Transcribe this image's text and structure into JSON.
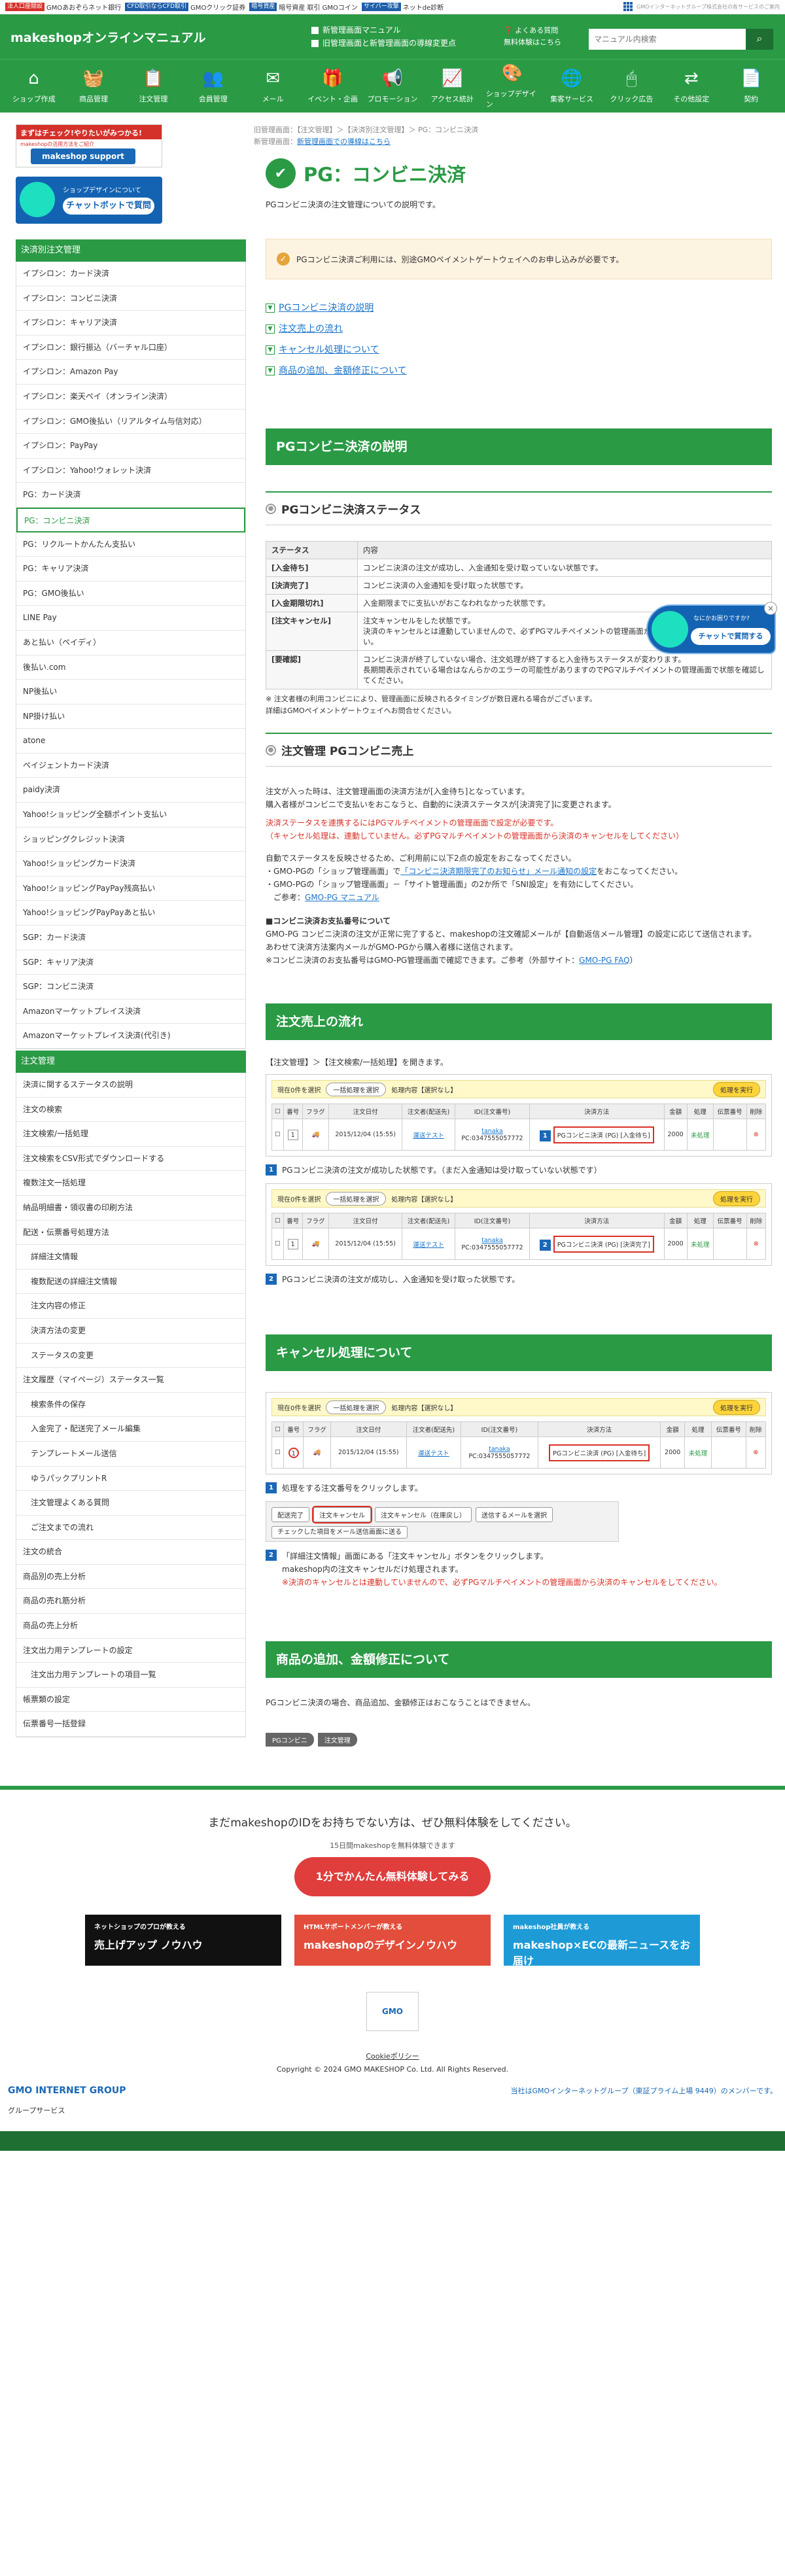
{
  "topbar": {
    "links": [
      {
        "tag": "法人口座開設",
        "tag_color": "#d4312b",
        "label": "GMOあおぞらネット銀行"
      },
      {
        "tag": "CFD取引ならCFD取引",
        "tag_color": "#1f5fa8",
        "label": "GMOクリック証券"
      },
      {
        "tag": "暗号資産",
        "tag_color": "#1f5fa8",
        "label": "暗号資産 取引 GMOコイン"
      },
      {
        "tag": "サイバー攻撃",
        "tag_color": "#1f5fa8",
        "label": "ネットde診断"
      }
    ],
    "right_text": "GMOインターネットグループ株式会社の各サービスのご案内"
  },
  "header": {
    "logo": "makeshopオンラインマニュアル",
    "link1": "新管理画面マニュアル",
    "link2": "旧管理画面と新管理画面の導線変更点",
    "faq": "よくある質問",
    "trial": "無料体験はこちら",
    "search_placeholder": "マニュアル内検索"
  },
  "iconnav": [
    {
      "label": "ショップ作成",
      "icon": "shop-icon"
    },
    {
      "label": "商品管理",
      "icon": "basket-icon"
    },
    {
      "label": "注文管理",
      "icon": "clipboard-icon"
    },
    {
      "label": "会員管理",
      "icon": "members-icon"
    },
    {
      "label": "メール",
      "icon": "mail-icon"
    },
    {
      "label": "イベント・企画",
      "icon": "gift-icon"
    },
    {
      "label": "プロモーション",
      "icon": "megaphone-icon"
    },
    {
      "label": "アクセス統計",
      "icon": "chart-icon"
    },
    {
      "label": "ショップデザイン",
      "icon": "palette-icon"
    },
    {
      "label": "集客サービス",
      "icon": "globe-icon"
    },
    {
      "label": "クリック広告",
      "icon": "click-icon"
    },
    {
      "label": "その他設定",
      "icon": "arrows-icon"
    },
    {
      "label": "契約",
      "icon": "contract-icon"
    }
  ],
  "sidebar": {
    "banner1": {
      "top": "まずはチェック!やりたいがみつかる!",
      "sub": "makeshopの活用方法をご紹介",
      "logo": "makeshop support"
    },
    "banner2": {
      "t1": "ショップデザインについて",
      "t2": "チャットボットで質問"
    },
    "section1": "決済別注文管理",
    "items1": [
      "イプシロン：カード決済",
      "イプシロン：コンビニ決済",
      "イプシロン：キャリア決済",
      "イプシロン：銀行振込（バーチャル口座）",
      "イプシロン：Amazon Pay",
      "イプシロン：楽天ペイ（オンライン決済）",
      "イプシロン：GMO後払い（リアルタイム与信対応）",
      "イプシロン：PayPay",
      "イプシロン：Yahoo!ウォレット決済",
      "PG：カード決済",
      "PG：コンビニ決済",
      "PG：リクルートかんたん支払い",
      "PG：キャリア決済",
      "PG：GMO後払い",
      "LINE Pay",
      "あと払い（ペイディ）",
      "後払い.com",
      "NP後払い",
      "NP掛け払い",
      "atone",
      "ペイジェントカード決済",
      "paidy決済",
      "Yahoo!ショッピング全額ポイント支払い",
      "ショッピングクレジット決済",
      "Yahoo!ショッピングカード決済",
      "Yahoo!ショッピングPayPay残高払い",
      "Yahoo!ショッピングPayPayあと払い",
      "SGP：カード決済",
      "SGP：キャリア決済",
      "SGP：コンビニ決済",
      "Amazonマーケットプレイス決済",
      "Amazonマーケットプレイス決済(代引き)"
    ],
    "current_index": 10,
    "section2": "注文管理",
    "items2": [
      "決済に関するステータスの説明",
      "注文の検索",
      "注文検索/一括処理",
      "注文検索をCSV形式でダウンロードする",
      "複数注文一括処理",
      "納品明細書・領収書の印刷方法",
      "配送・伝票番号処理方法",
      "詳細注文情報",
      "複数配送の詳細注文情報",
      "注文内容の修正",
      "決済方法の変更",
      "ステータスの変更",
      "注文履歴（マイページ）ステータス一覧",
      "検索条件の保存",
      "入金完了・配送完了メール編集",
      "テンプレートメール送信",
      "ゆうパックプリントR",
      "注文管理よくある質問",
      "ご注文までの流れ",
      "注文の統合",
      "商品別の売上分析",
      "商品の売れ筋分析",
      "商品の売上分析",
      "注文出力用テンプレートの設定",
      "注文出力用テンプレートの項目一覧",
      "帳票類の設定",
      "伝票番号一括登録"
    ],
    "sub_items2": [
      7,
      8,
      9,
      10,
      11,
      13,
      14,
      15,
      16,
      17,
      18,
      24
    ]
  },
  "main": {
    "breadcrumb1": "旧管理画面：【注文管理】＞【決済別注文管理】＞ PG：コンビニ決済",
    "breadcrumb2_prefix": "新管理画面：",
    "breadcrumb2_link": "新管理画面での導線はこちら",
    "title": "PG：コンビニ決済",
    "lead": "PGコンビニ決済の注文管理についての説明です。",
    "notice": "PGコンビニ決済ご利用には、別途GMOペイメントゲートウェイへのお申し込みが必要です。",
    "anchors": [
      "PGコンビニ決済の説明",
      "注文売上の流れ",
      "キャンセル処理について",
      "商品の追加、金額修正について"
    ],
    "sec1": "PGコンビニ決済の説明",
    "sub1": "PGコンビニ決済ステータス",
    "status_head": [
      "ステータス",
      "内容"
    ],
    "status_rows": [
      [
        "[入金待ち]",
        "コンビニ決済の注文が成功し、入金通知を受け取っていない状態です。"
      ],
      [
        "[決済完了]",
        "コンビニ決済の入金通知を受け取った状態です。"
      ],
      [
        "[入金期限切れ]",
        "入金期限までに支払いがおこなわれなかった状態です。"
      ],
      [
        "[注文キャンセル]",
        "注文キャンセルをした状態です。\n決済のキャンセルとは連動していませんので、必ずPGマルチペイメントの管理画面から決済のキャンセルをしてください。"
      ],
      [
        "[要確認]",
        "コンビニ決済が終了していない場合、注文処理が終了すると入金待ちステータスが変わります。\n長期間表示されている場合はなんらかのエラーの可能性がありますのでPGマルチペイメントの管理画面で状態を確認してください。"
      ]
    ],
    "status_note1": "※ 注文者様の利用コンビニにより、管理画面に反映されるタイミングが数日遅れる場合がございます。",
    "status_note2": "詳細はGMOペイメントゲートウェイへお問合せください。",
    "sub2": "注文管理 PGコンビニ売上",
    "p2_1": "注文が入った時は、注文管理画面の決済方法が[入金待ち]となっています。",
    "p2_2": "購入者様がコンビニで支払いをおこなうと、自動的に決済ステータスが[決済完了]に変更されます。",
    "p2_red1": "決済ステータスを連携するにはPGマルチペイメントの管理画面で設定が必要です。",
    "p2_red2": "（キャンセル処理は、連動していません。必ずPGマルチペイメントの管理画面から決済のキャンセルをしてください）",
    "p2_3": "自動でステータスを反映させるため、ご利用前に以下2点の設定をおこなってください。",
    "p2_b1_a": "・GMO-PGの「ショップ管理画面」で",
    "p2_b1_link": "「コンビニ決済期限完了のお知らせ」メール通知の設定",
    "p2_b1_b": "をおこなってください。",
    "p2_b2": "・GMO-PGの「ショップ管理画面」－「サイト管理画面」の2か所で「SNI設定」を有効にしてください。",
    "p2_b2_ref": "ご参考：",
    "p2_b2_link": "GMO-PG マニュアル",
    "p2_h": "■コンビニ決済お支払番号について",
    "p2_4": "GMO-PG コンビニ決済の注文が正常に完了すると、makeshopの注文確認メールが【自動返信メール管理】の設定に応じて送信されます。",
    "p2_5": "あわせて決済方法案内メールがGMO-PGから購入者様に送信されます。",
    "p2_6_a": "※コンビニ決済のお支払番号はGMO-PG管理画面で確認できます。ご参考（外部サイト：",
    "p2_6_link": "GMO-PG FAQ",
    "p2_6_b": "）",
    "sec2": "注文売上の流れ",
    "flow_intro": "【注文管理】＞【注文検索/一括処理】を開きます。",
    "scr": {
      "bar_label": "現在0件を選択",
      "bar_btn": "一括処理を選択",
      "bar_mid": "処理内容【選択なし】",
      "bar_exec": "処理を実行",
      "cols": [
        "番号",
        "フラグ",
        "注文日付",
        "注文者(配送先)",
        "ID(注文番号)",
        "決済方法",
        "金額",
        "処理",
        "伝票番号",
        "削除"
      ],
      "date": "2015/12/04 (15:55)",
      "buyer": "運送テスト",
      "id_link": "tanaka",
      "id_sub": "PC:0347555057772",
      "amount": "2000",
      "process": "未処理",
      "pay1": "PGコンビニ決済 (PG) [入金待ち]",
      "pay2": "PGコンビニ決済 (PG) [決済完了]"
    },
    "flow_step1": "PGコンビニ決済の注文が成功した状態です。（まだ入金通知は受け取っていない状態です）",
    "flow_step2": "PGコンビニ決済の注文が成功し、入金通知を受け取った状態です。",
    "sec3": "キャンセル処理について",
    "cancel_step1": "処理をする注文番号をクリックします。",
    "cancel_btns": [
      "配送完了",
      "注文キャンセル",
      "注文キャンセル（在庫戻し）",
      "送信するメールを選択"
    ],
    "cancel_btn_extra": "チェックした項目をメール送信画面に送る",
    "cancel_step2_a": "「詳細注文情報」画面にある「注文キャンセル」ボタンをクリックします。",
    "cancel_step2_b": "makeshop内の注文キャンセルだけ処理されます。",
    "cancel_step2_red": "※決済のキャンセルとは連動していませんので、必ずPGマルチペイメントの管理画面から決済のキャンセルをしてください。",
    "sec4": "商品の追加、金額修正について",
    "sec4_text": "PGコンビニ決済の場合、商品追加、金額修正はおこなうことはできません。",
    "tags": [
      "PGコンビニ",
      "注文管理"
    ]
  },
  "floating": {
    "t1": "なにかお困りですか?",
    "t2": "チャットで質問する"
  },
  "footer": {
    "headline": "まだmakeshopのIDをお持ちでない方は、ぜひ無料体験をしてください。",
    "sub": "15日間makeshopを無料体験できます",
    "cta": "1分でかんたん無料体験してみる",
    "banners": [
      {
        "t1": "ネットショップのプロが教える",
        "t2": "売上げアップ ノウハウ",
        "bg": "#111"
      },
      {
        "t1": "HTMLサポートメンバーが教える",
        "t2": "makeshopのデザインノウハウ",
        "bg": "#e24e3b"
      },
      {
        "t1": "makeshop社員が教える",
        "t2": "makeshop×ECの最新ニュースをお届け",
        "bg": "#1e9bd7"
      }
    ],
    "gmo_badge": "GMO",
    "cookie": "Cookieポリシー",
    "copyright": "Copyright © 2024 GMO MAKESHOP Co. Ltd. All Rights Reserved.",
    "gmo_group": "GMO INTERNET GROUP",
    "gmo_right": "当社はGMOインターネットグループ（東証プライム上場 9449）のメンバーです。",
    "group_label": "グループサービス"
  }
}
